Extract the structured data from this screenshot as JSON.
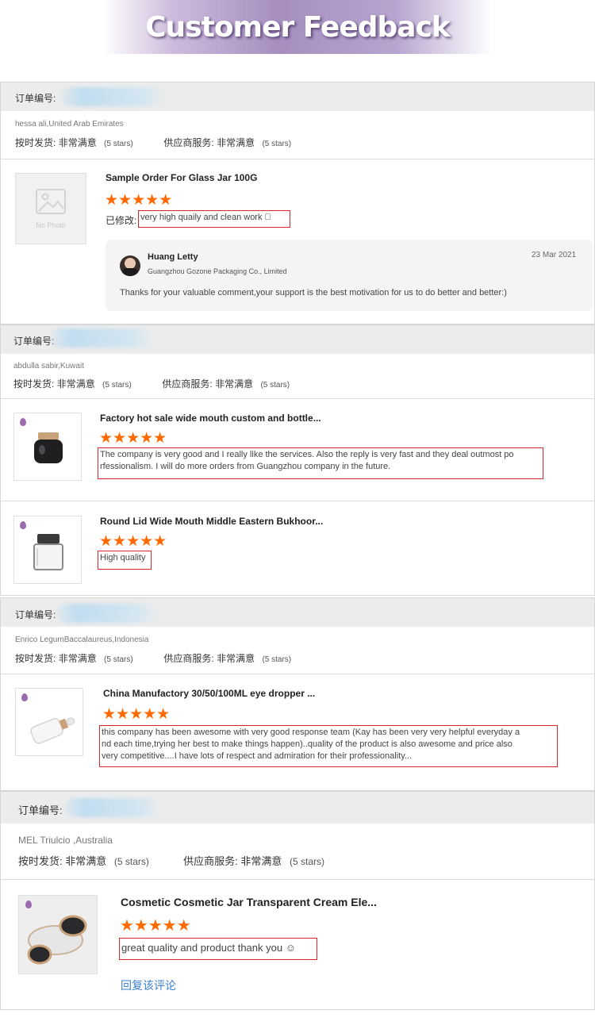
{
  "banner": {
    "title": "Customer Feedback"
  },
  "labels": {
    "order_no": "订单编号:",
    "on_time": "按时发货:",
    "supplier_service": "供应商服务:",
    "very_satisfied": "非常满意",
    "five_stars": "(5 stars)",
    "modified": "已修改:",
    "no_photo": "No Photo",
    "stars": "★★★★★"
  },
  "reviews": [
    {
      "buyer": "hessa ali,United Arab Emirates",
      "items": [
        {
          "name": "Sample Order For Glass Jar 100G",
          "comment": "very high quaily and clean work 􀀀",
          "modified": true
        }
      ],
      "reply": {
        "name": "Huang Letty",
        "company": "Guangzhou Gozone Packaging Co., Limited",
        "date": "23 Mar 2021",
        "text": "Thanks for your valuable comment,your support is the best motivation for us to do better and better:)"
      }
    },
    {
      "buyer": "abdulla sabir,Kuwait",
      "items": [
        {
          "name": "Factory hot sale wide mouth custom and bottle...",
          "comment_lines": [
            "The company is very good and I really like the services. Also the reply is very fast and they deal outmost po",
            "rfessionalism. I will do more orders from Guangzhou company in the future."
          ]
        },
        {
          "name": "Round Lid Wide Mouth Middle Eastern Bukhoor...",
          "comment": "High quality"
        }
      ]
    },
    {
      "buyer": "Enrico LegumBaccalaureus,Indonesia",
      "items": [
        {
          "name": "China Manufactory 30/50/100ML eye dropper ...",
          "comment_lines": [
            "this company has been awesome with very good response team (Kay has been very very helpful everyday a",
            "nd each time,trying her best to make things happen)..quality of the product is also awesome and price also",
            "very competitive....I have lots of respect and admiration for their professionality..."
          ]
        }
      ]
    },
    {
      "buyer": "MEL Triulcio ,Australia",
      "items": [
        {
          "name": "Cosmetic Cosmetic Jar Transparent Cream Ele...",
          "comment": "great quality and product thank you ☺"
        }
      ],
      "reply_link": "回复该评论"
    }
  ],
  "colors": {
    "star": "#ff6a00",
    "highlight_border": "#d9252b",
    "link": "#3a7fd0",
    "header_bg": "#ececec"
  }
}
